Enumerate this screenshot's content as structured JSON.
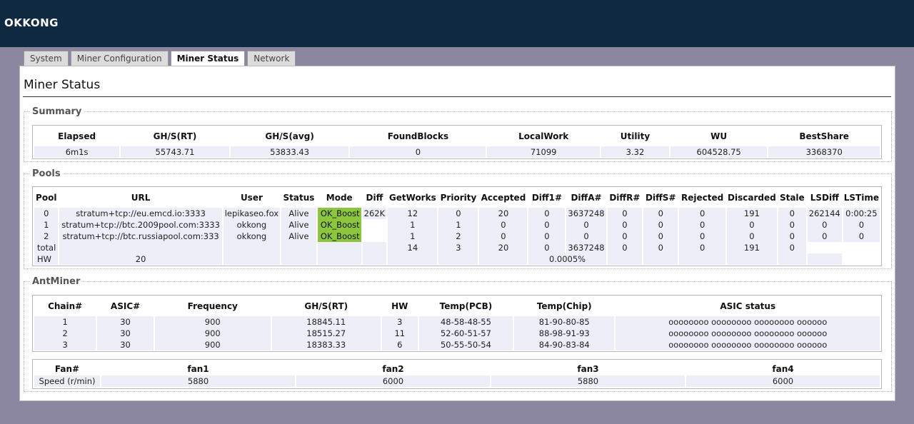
{
  "app": {
    "logo": "OKKONG"
  },
  "tabs": [
    {
      "label": "System"
    },
    {
      "label": "Miner Configuration"
    },
    {
      "label": "Miner Status",
      "active": true
    },
    {
      "label": "Network"
    }
  ],
  "page_title": "Miner Status",
  "summary": {
    "legend": "Summary",
    "headers": [
      "Elapsed",
      "GH/S(RT)",
      "GH/S(avg)",
      "FoundBlocks",
      "LocalWork",
      "Utility",
      "WU",
      "BestShare"
    ],
    "values": [
      "6m1s",
      "55743.71",
      "53833.43",
      "0",
      "71099",
      "3.32",
      "604528.75",
      "3368370"
    ]
  },
  "pools": {
    "legend": "Pools",
    "headers": [
      "Pool",
      "URL",
      "User",
      "Status",
      "Mode",
      "Diff",
      "GetWorks",
      "Priority",
      "Accepted",
      "Diff1#",
      "DiffA#",
      "DiffR#",
      "DiffS#",
      "Rejected",
      "Discarded",
      "Stale",
      "LSDiff",
      "LSTime"
    ],
    "rows": [
      [
        "0",
        "stratum+tcp://eu.emcd.io:3333",
        "lepikaseo.fox",
        "Alive",
        "OK_Boost",
        "262K",
        "12",
        "0",
        "20",
        "0",
        "3637248",
        "0",
        "0",
        "0",
        "191",
        "0",
        "262144",
        "0:00:25"
      ],
      [
        "1",
        "stratum+tcp://btc.2009pool.com:3333",
        "okkong",
        "Alive",
        "OK_Boost",
        "",
        "1",
        "1",
        "0",
        "0",
        "0",
        "0",
        "0",
        "0",
        "0",
        "0",
        "0",
        "0"
      ],
      [
        "2",
        "stratum+tcp://btc.russiapool.com:333",
        "okkong",
        "Alive",
        "OK_Boost",
        "",
        "1",
        "2",
        "0",
        "0",
        "0",
        "0",
        "0",
        "0",
        "0",
        "0",
        "0",
        "0"
      ]
    ],
    "total_row": [
      "total",
      "",
      "",
      "",
      "",
      "",
      "14",
      "3",
      "20",
      "0",
      "3637248",
      "0",
      "0",
      "0",
      "191",
      "0",
      "",
      ""
    ],
    "hw_row": {
      "label": "HW",
      "value": "20",
      "rate": "0.0005%"
    },
    "mode_color": "#8cc63f"
  },
  "antminer": {
    "legend": "AntMiner",
    "headers": [
      "Chain#",
      "ASIC#",
      "Frequency",
      "GH/S(RT)",
      "HW",
      "Temp(PCB)",
      "Temp(Chip)",
      "ASIC status"
    ],
    "rows": [
      [
        "1",
        "30",
        "900",
        "18845.11",
        "3",
        "48-58-48-55",
        "81-90-80-85",
        "oooooooo oooooooo oooooooo oooooo"
      ],
      [
        "2",
        "30",
        "900",
        "18515.27",
        "11",
        "52-60-51-57",
        "88-98-91-93",
        "oooooooo oooooooo oooooooo oooooo"
      ],
      [
        "3",
        "30",
        "900",
        "18383.33",
        "6",
        "50-55-50-54",
        "84-90-83-84",
        "oooooooo oooooooo oooooooo oooooo"
      ]
    ],
    "fan_headers": [
      "Fan#",
      "fan1",
      "fan2",
      "fan3",
      "fan4"
    ],
    "fan_row": [
      "Speed (r/min)",
      "5880",
      "6000",
      "5880",
      "6000"
    ]
  },
  "colors": {
    "header_bg": "#0f2a40",
    "page_bg": "#8c87a0",
    "cell_bg": "#eeeef8"
  }
}
